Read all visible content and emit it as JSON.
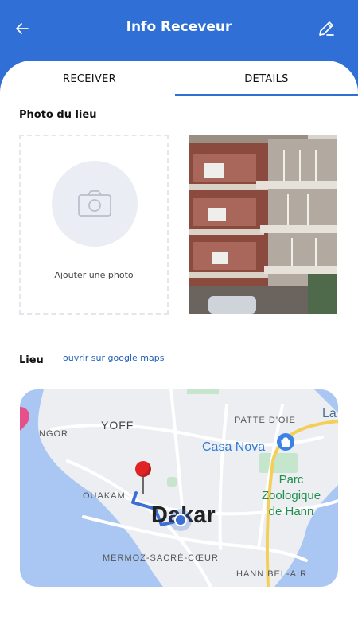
{
  "header": {
    "title": "Info Receveur",
    "background": "#2f6fd6",
    "back_icon": "arrow-left-icon",
    "edit_icon": "pencil-icon"
  },
  "tabs": [
    {
      "label": "RECEIVER",
      "active": false
    },
    {
      "label": "DETAILS",
      "active": true
    }
  ],
  "photo_section": {
    "title": "Photo du lieu",
    "add_label": "Ajouter une photo",
    "add_icon": "camera-icon",
    "thumbnail": "building-photo"
  },
  "location_section": {
    "title": "Lieu",
    "maps_link": "ouvrir sur google maps"
  },
  "map": {
    "labels": {
      "yoff": "YOFF",
      "ngor": "NGOR",
      "patte_doie": "PATTE D'OIE",
      "la": "La",
      "casa_nova": "Casa Nova",
      "ouakam": "OUAKAM",
      "parc_line1": "Parc",
      "parc_line2": "Zoologique",
      "parc_line3": "de Hann",
      "dakar": "Dakar",
      "mermoz": "MERMOZ-SACRÉ-CŒUR",
      "hann": "HANN BEL-AIR"
    },
    "pin_icon": "red-pin-icon",
    "location_icon": "blue-dot-icon",
    "store_icon": "shopping-bag-icon"
  }
}
